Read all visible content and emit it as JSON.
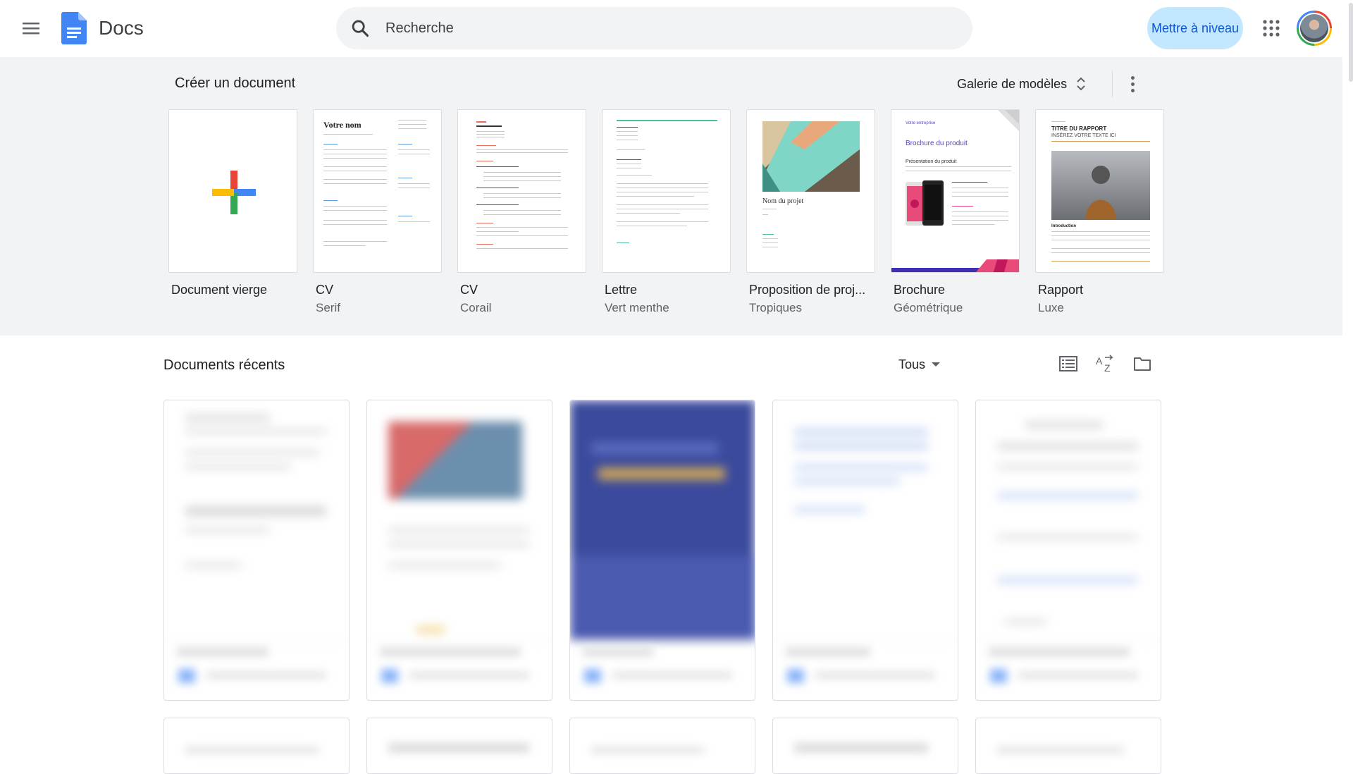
{
  "header": {
    "app_name": "Docs",
    "search_placeholder": "Recherche",
    "upgrade_label": "Mettre à niveau",
    "icons": [
      "menu-icon",
      "docs-logo-icon",
      "search-icon",
      "apps-grid-icon",
      "avatar"
    ]
  },
  "templates": {
    "title": "Créer un document",
    "gallery_label": "Galerie de modèles",
    "items": [
      {
        "name": "Document vierge",
        "sub": ""
      },
      {
        "name": "CV",
        "sub": "Serif"
      },
      {
        "name": "CV",
        "sub": "Corail"
      },
      {
        "name": "Lettre",
        "sub": "Vert menthe"
      },
      {
        "name": "Proposition de proj...",
        "sub": "Tropiques"
      },
      {
        "name": "Brochure",
        "sub": "Géométrique"
      },
      {
        "name": "Rapport",
        "sub": "Luxe"
      }
    ],
    "thumb_text": {
      "cv_name": "Votre nom",
      "project_name": "Nom du projet",
      "brochure_company": "Votre entreprise",
      "brochure_title": "Brochure du produit",
      "brochure_section": "Présentation du produit",
      "report_title": "TITRE DU RAPPORT",
      "report_sub": "INSÉREZ VOTRE TEXTE ICI",
      "report_section": "Introduction"
    }
  },
  "recent": {
    "title": "Documents récents",
    "filter_label": "Tous"
  },
  "colors": {
    "accent": "#0b57d0",
    "upgrade_bg": "#c2e7ff",
    "strip_bg": "#f1f3f4"
  }
}
